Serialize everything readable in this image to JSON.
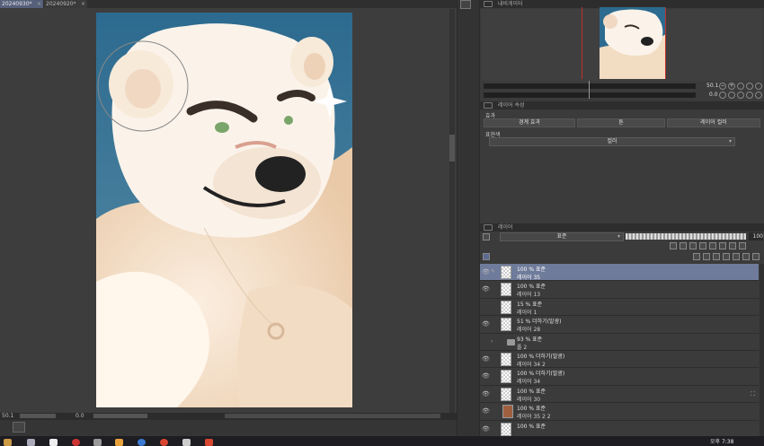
{
  "documents": {
    "tabs": [
      {
        "label": "20240930*",
        "active": true
      },
      {
        "label": "20240920*",
        "active": false
      }
    ],
    "close_glyph": "×"
  },
  "canvas_status": {
    "zoom": "50.1",
    "angle": "0.0"
  },
  "navigator": {
    "title": "내비게이터",
    "zoom": "50.1",
    "angle": "0.0"
  },
  "layer_property": {
    "title": "레이어 속성",
    "effect_label": "효과",
    "effects": [
      "경계 효과",
      "톤",
      "레이어 컬러"
    ],
    "expression_label": "표현색",
    "expression_value": "컬러"
  },
  "layer_panel": {
    "title": "레이어",
    "blend_mode": "표준",
    "opacity": "100",
    "layers": [
      {
        "line1": "100 % 표준",
        "line2": "레이어 35",
        "selected": true,
        "visible": true,
        "type": "raster"
      },
      {
        "line1": "100 % 표준",
        "line2": "레이어 13",
        "selected": false,
        "visible": true,
        "type": "raster"
      },
      {
        "line1": "15 % 표준",
        "line2": "레이어 1",
        "selected": false,
        "visible": false,
        "type": "raster"
      },
      {
        "line1": "51 % 더하기(발광)",
        "line2": "레이어 28",
        "selected": false,
        "visible": true,
        "type": "raster"
      },
      {
        "line1": "93 % 표준",
        "line2": "폴 2",
        "selected": false,
        "visible": false,
        "type": "folder"
      },
      {
        "line1": "100 % 더하기(발광)",
        "line2": "레이어 34 2",
        "selected": false,
        "visible": true,
        "type": "raster"
      },
      {
        "line1": "100 % 더하기(발광)",
        "line2": "레이어 34",
        "selected": false,
        "visible": true,
        "type": "raster"
      },
      {
        "line1": "100 % 표준",
        "line2": "레이어 30",
        "selected": false,
        "visible": true,
        "type": "raster"
      },
      {
        "line1": "100 % 표준",
        "line2": "레이어 35 2 2",
        "selected": false,
        "visible": true,
        "type": "image"
      },
      {
        "line1": "100 % 표준",
        "line2": "",
        "selected": false,
        "visible": true,
        "type": "raster"
      }
    ]
  },
  "taskbar": {
    "time": "오후 7:38"
  },
  "colors": {
    "artwork_bg": "#2e6d93",
    "selected_layer": "#6f7b9a",
    "nav_frame": "#c2302a",
    "active_tab": "#56607a"
  }
}
